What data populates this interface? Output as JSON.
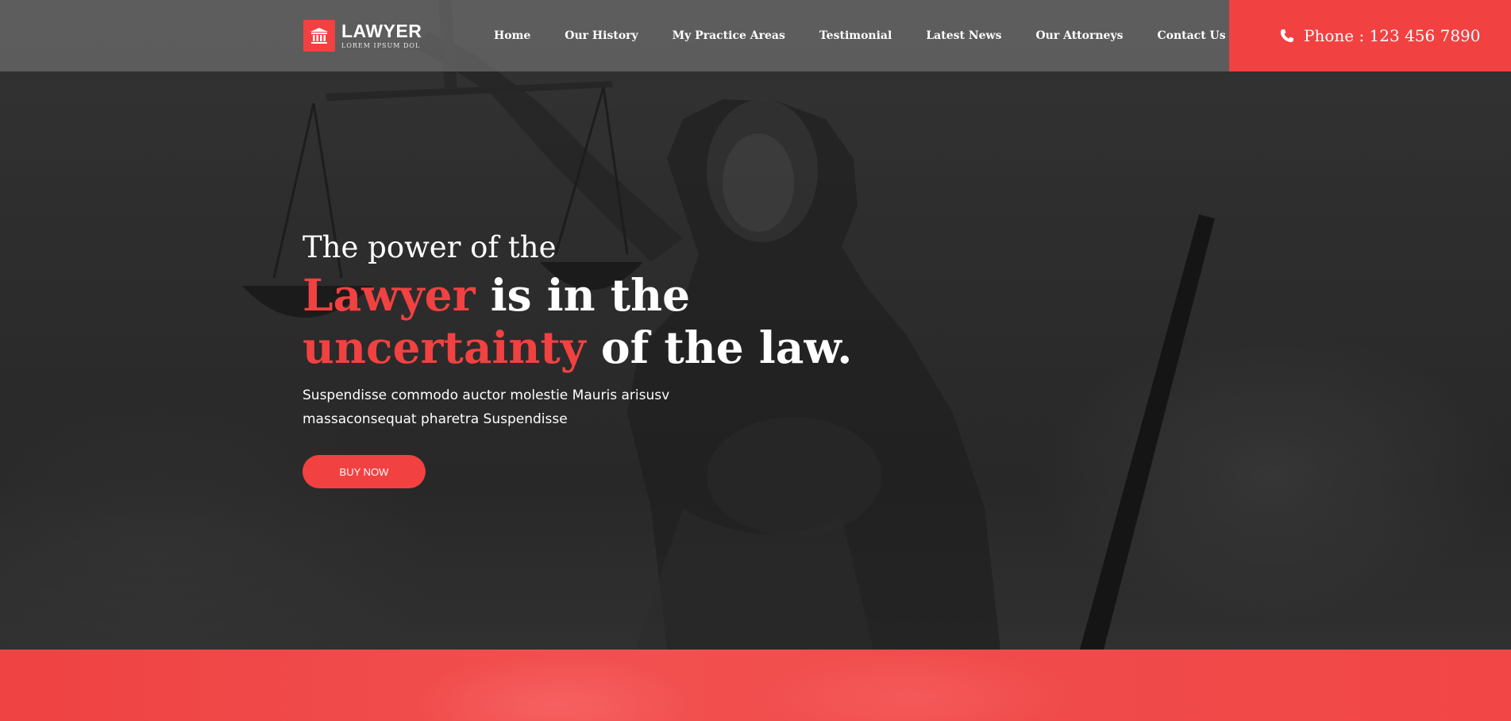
{
  "brand": {
    "name": "LAWYER",
    "tagline": "LOREM IPSUM DOL",
    "accent_color": "#f24141"
  },
  "nav": {
    "items": [
      {
        "label": "Home"
      },
      {
        "label": "Our History"
      },
      {
        "label": "My Practice Areas"
      },
      {
        "label": "Testimonial"
      },
      {
        "label": "Latest News"
      },
      {
        "label": "Our Attorneys"
      },
      {
        "label": "Contact Us"
      }
    ],
    "search_icon": "search-icon"
  },
  "phone": {
    "icon": "phone-icon",
    "text": "Phone : 123 456 7890"
  },
  "hero": {
    "line1": "The power of the",
    "headline_1_accent": "Lawyer",
    "headline_1_rest": " is in the",
    "headline_2_accent": "uncertainty",
    "headline_2_rest": " of the law.",
    "paragraph_line1": "Suspendisse commodo auctor molestie Mauris arisusv",
    "paragraph_line2": "massaconsequat pharetra Suspendisse",
    "button_label": "BUY NOW"
  }
}
